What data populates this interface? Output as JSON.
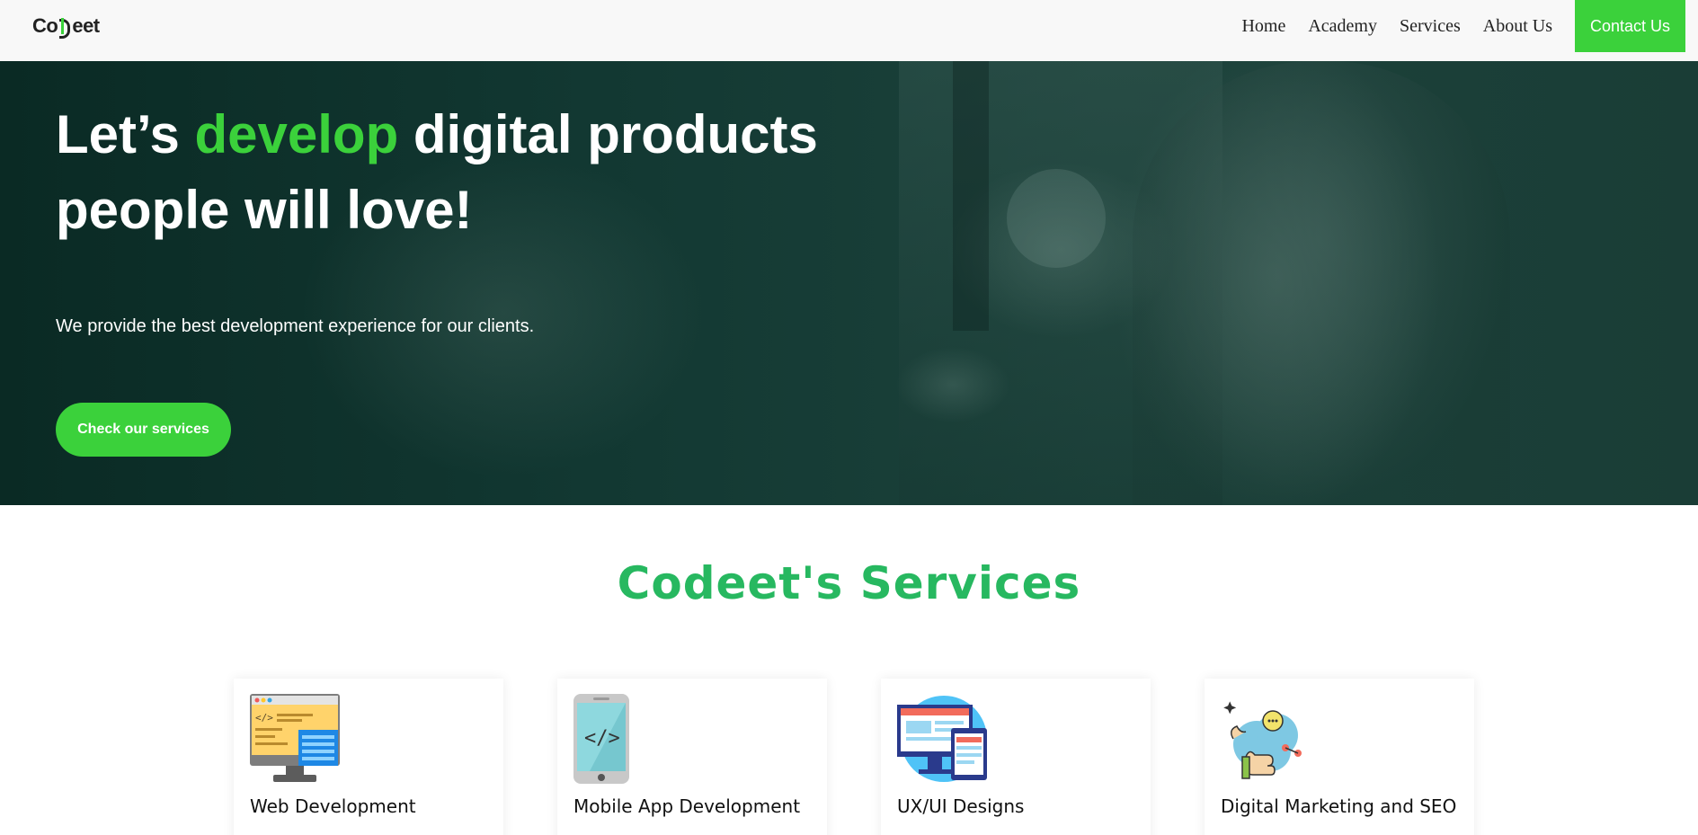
{
  "brand": {
    "logo_prefix": "Co",
    "logo_suffix": "eet",
    "accent": "#3bd13b",
    "heading_green": "#27b860"
  },
  "nav": {
    "links": [
      "Home",
      "Academy",
      "Services",
      "About Us"
    ],
    "contact_label": "Contact Us"
  },
  "hero": {
    "title_part1": "Let’s ",
    "title_highlight": "develop",
    "title_part2": " digital products people will love!",
    "subtitle": "We provide the best development experience for our clients.",
    "cta_label": "Check our services"
  },
  "services": {
    "heading": "Codeet's Services",
    "items": [
      {
        "label": "Web Development",
        "icon": "web-development-icon"
      },
      {
        "label": "Mobile App Development",
        "icon": "mobile-app-icon"
      },
      {
        "label": "UX/UI Designs",
        "icon": "ux-ui-design-icon"
      },
      {
        "label": "Digital Marketing and SEO",
        "icon": "digital-marketing-icon"
      }
    ]
  }
}
